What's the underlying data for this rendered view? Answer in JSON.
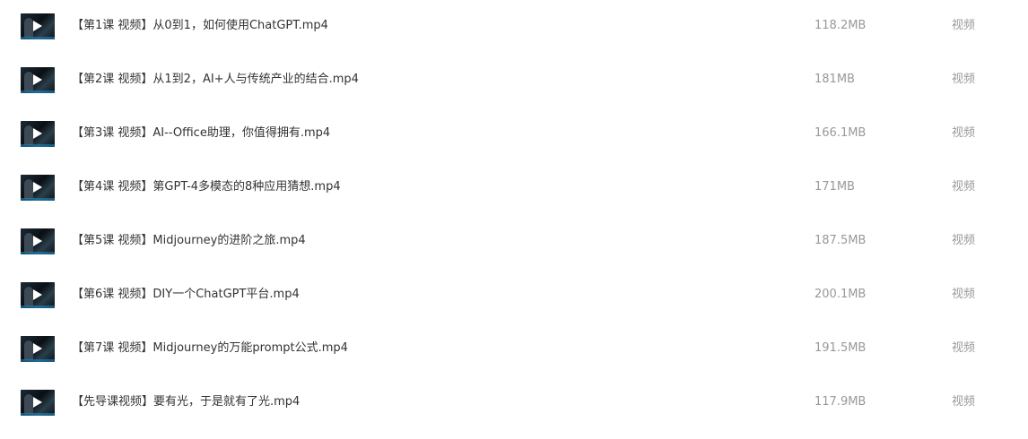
{
  "files": [
    {
      "name": "【第1课 视频】从0到1，如何使用ChatGPT.mp4",
      "size": "118.2MB",
      "type": "视频",
      "thumbnail_icon": "video-thumbnail-icon"
    },
    {
      "name": "【第2课 视频】从1到2，AI+人与传统产业的结合.mp4",
      "size": "181MB",
      "type": "视频",
      "thumbnail_icon": "video-thumbnail-icon"
    },
    {
      "name": "【第3课 视频】AI--Office助理，你值得拥有.mp4",
      "size": "166.1MB",
      "type": "视频",
      "thumbnail_icon": "video-thumbnail-icon"
    },
    {
      "name": "【第4课 视频】第GPT-4多模态的8种应用猜想.mp4",
      "size": "171MB",
      "type": "视频",
      "thumbnail_icon": "video-thumbnail-icon"
    },
    {
      "name": "【第5课 视频】Midjourney的进阶之旅.mp4",
      "size": "187.5MB",
      "type": "视频",
      "thumbnail_icon": "video-thumbnail-icon"
    },
    {
      "name": "【第6课 视频】DIY一个ChatGPT平台.mp4",
      "size": "200.1MB",
      "type": "视频",
      "thumbnail_icon": "video-thumbnail-icon"
    },
    {
      "name": "【第7课 视频】Midjourney的万能prompt公式.mp4",
      "size": "191.5MB",
      "type": "视频",
      "thumbnail_icon": "video-thumbnail-icon"
    },
    {
      "name": "【先导课视频】要有光，于是就有了光.mp4",
      "size": "117.9MB",
      "type": "视频",
      "thumbnail_icon": "video-thumbnail-icon"
    }
  ]
}
